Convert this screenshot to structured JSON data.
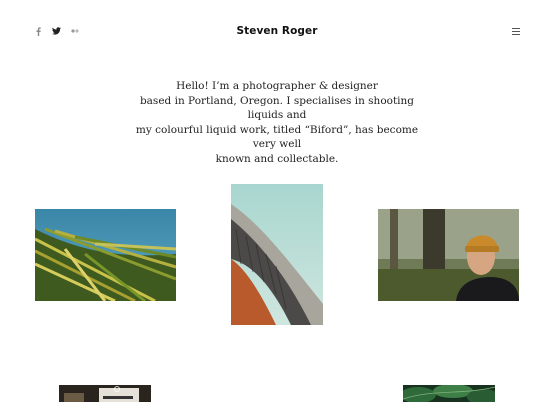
{
  "header": {
    "title": "Steven Roger",
    "social": [
      {
        "icon": "facebook-icon",
        "glyph": "f"
      },
      {
        "icon": "twitter-icon",
        "glyph": ""
      },
      {
        "icon": "flickr-icon",
        "glyph": ""
      }
    ],
    "menu_icon": "hamburger-menu-icon"
  },
  "intro": {
    "lines": [
      "Hello! I’m a photographer & designer",
      "based in Portland, Oregon. I specialises in shooting liquids and",
      "my colourful liquid work, titled “Biford”, has become very well",
      "known and collectable."
    ]
  },
  "gallery": [
    {
      "subject": "palm-leaf-photo"
    },
    {
      "subject": "architecture-photo"
    },
    {
      "subject": "man-in-beanie-photo"
    },
    {
      "subject": "magazine-photo"
    },
    {
      "subject": "green-leaves-photo"
    }
  ],
  "colors": {
    "background": "#ffffff",
    "text": "#111111",
    "icon": "#777777"
  }
}
